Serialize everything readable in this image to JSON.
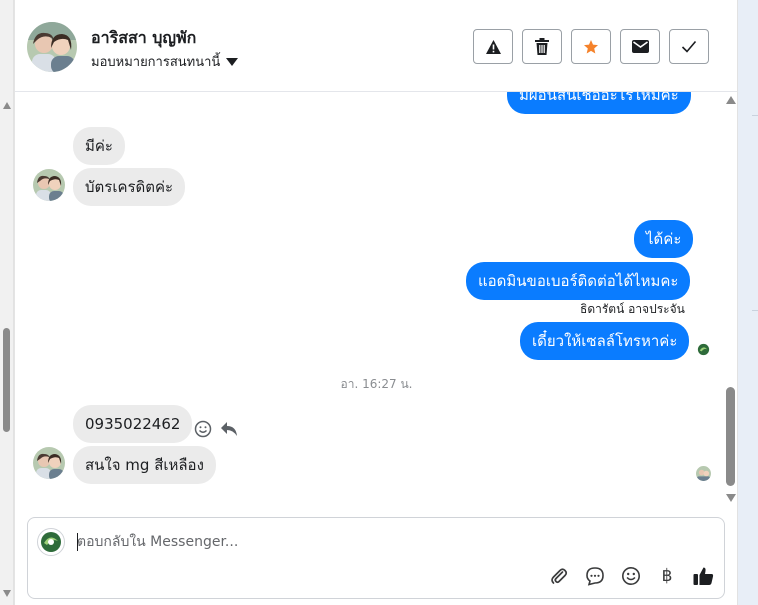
{
  "header": {
    "customer_name": "อาริสสา บุญพัก",
    "assign_label": "มอบหมายการสนทนานี้",
    "actions": [
      {
        "icon": "warning-icon",
        "label": "Spam"
      },
      {
        "icon": "trash-icon",
        "label": "Delete"
      },
      {
        "icon": "star-icon",
        "label": "Star"
      },
      {
        "icon": "envelope-icon",
        "label": "Mark unread"
      },
      {
        "icon": "check-icon",
        "label": "Mark done"
      }
    ]
  },
  "messages": {
    "partial_out": "มีผ่อนสินเชื่ออะไรไหมคะ",
    "in_1": "มีค่ะ",
    "in_2": "บัตรเครดิตค่ะ",
    "out_1": "ได้ค่ะ",
    "out_2": "แอดมินขอเบอร์ติดต่อได้ไหมคะ",
    "agent_name": "ธิดารัตน์ อาจประจัน",
    "out_3": "เดี๋ยวให้เซลล์โทรหาค่ะ",
    "timestamp": "อา. 16:27 น.",
    "in_3": "0935022462",
    "in_4": "สนใจ mg สีเหลือง"
  },
  "composer": {
    "placeholder": "ตอบกลับใน Messenger..."
  },
  "colors": {
    "outgoing_bubble": "#0a7cff",
    "incoming_bubble": "#ebebeb",
    "star_accent": "#f5822a"
  }
}
